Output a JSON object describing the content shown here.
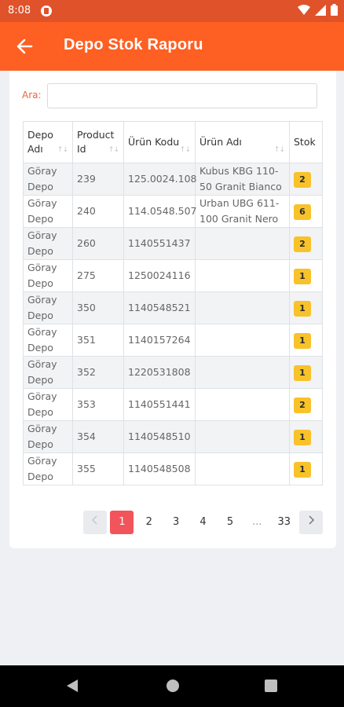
{
  "status_bar": {
    "time": "8:08",
    "icons": [
      "app-notification-icon",
      "wifi-icon",
      "signal-icon",
      "battery-icon"
    ]
  },
  "app_bar": {
    "title": "Depo Stok Raporu",
    "back_icon": "arrow-left-icon",
    "color": "#fe5f22"
  },
  "search": {
    "label": "Ara:",
    "value": "",
    "placeholder": ""
  },
  "table": {
    "columns": [
      {
        "label": "Depo Adı",
        "sortable": true
      },
      {
        "label": "Product Id",
        "sortable": true
      },
      {
        "label": "Ürün Kodu",
        "sortable": true
      },
      {
        "label": "Ürün Adı",
        "sortable": true
      },
      {
        "label": "Stok",
        "sortable": false
      }
    ],
    "rows": [
      {
        "depo": "Göray Depo",
        "product_id": "239",
        "urun_kodu": "125.0024.108",
        "urun_adi": "Kubus KBG 110-50 Granit Bianco",
        "stok": "2"
      },
      {
        "depo": "Göray Depo",
        "product_id": "240",
        "urun_kodu": "114.0548.507",
        "urun_adi": "Urban UBG 611-100 Granit Nero",
        "stok": "6"
      },
      {
        "depo": "Göray Depo",
        "product_id": "260",
        "urun_kodu": "1140551437",
        "urun_adi": "",
        "stok": "2"
      },
      {
        "depo": "Göray Depo",
        "product_id": "275",
        "urun_kodu": "1250024116",
        "urun_adi": "",
        "stok": "1"
      },
      {
        "depo": "Göray Depo",
        "product_id": "350",
        "urun_kodu": "1140548521",
        "urun_adi": "",
        "stok": "1"
      },
      {
        "depo": "Göray Depo",
        "product_id": "351",
        "urun_kodu": "1140157264",
        "urun_adi": "",
        "stok": "1"
      },
      {
        "depo": "Göray Depo",
        "product_id": "352",
        "urun_kodu": "1220531808",
        "urun_adi": "",
        "stok": "1"
      },
      {
        "depo": "Göray Depo",
        "product_id": "353",
        "urun_kodu": "1140551441",
        "urun_adi": "",
        "stok": "2"
      },
      {
        "depo": "Göray Depo",
        "product_id": "354",
        "urun_kodu": "1140548510",
        "urun_adi": "",
        "stok": "1"
      },
      {
        "depo": "Göray Depo",
        "product_id": "355",
        "urun_kodu": "1140548508",
        "urun_adi": "",
        "stok": "1"
      }
    ]
  },
  "pagination": {
    "prev_icon": "chevron-left-icon",
    "next_icon": "chevron-right-icon",
    "pages": [
      "1",
      "2",
      "3",
      "4",
      "5",
      "...",
      "33"
    ],
    "active": "1"
  },
  "colors": {
    "accent": "#fe5f22",
    "status_bar": "#e0522a",
    "badge": "#f8c22a",
    "active_page": "#f2545b"
  },
  "nav_bar": {
    "icons": [
      "back-triangle-icon",
      "home-circle-icon",
      "recents-square-icon"
    ]
  }
}
